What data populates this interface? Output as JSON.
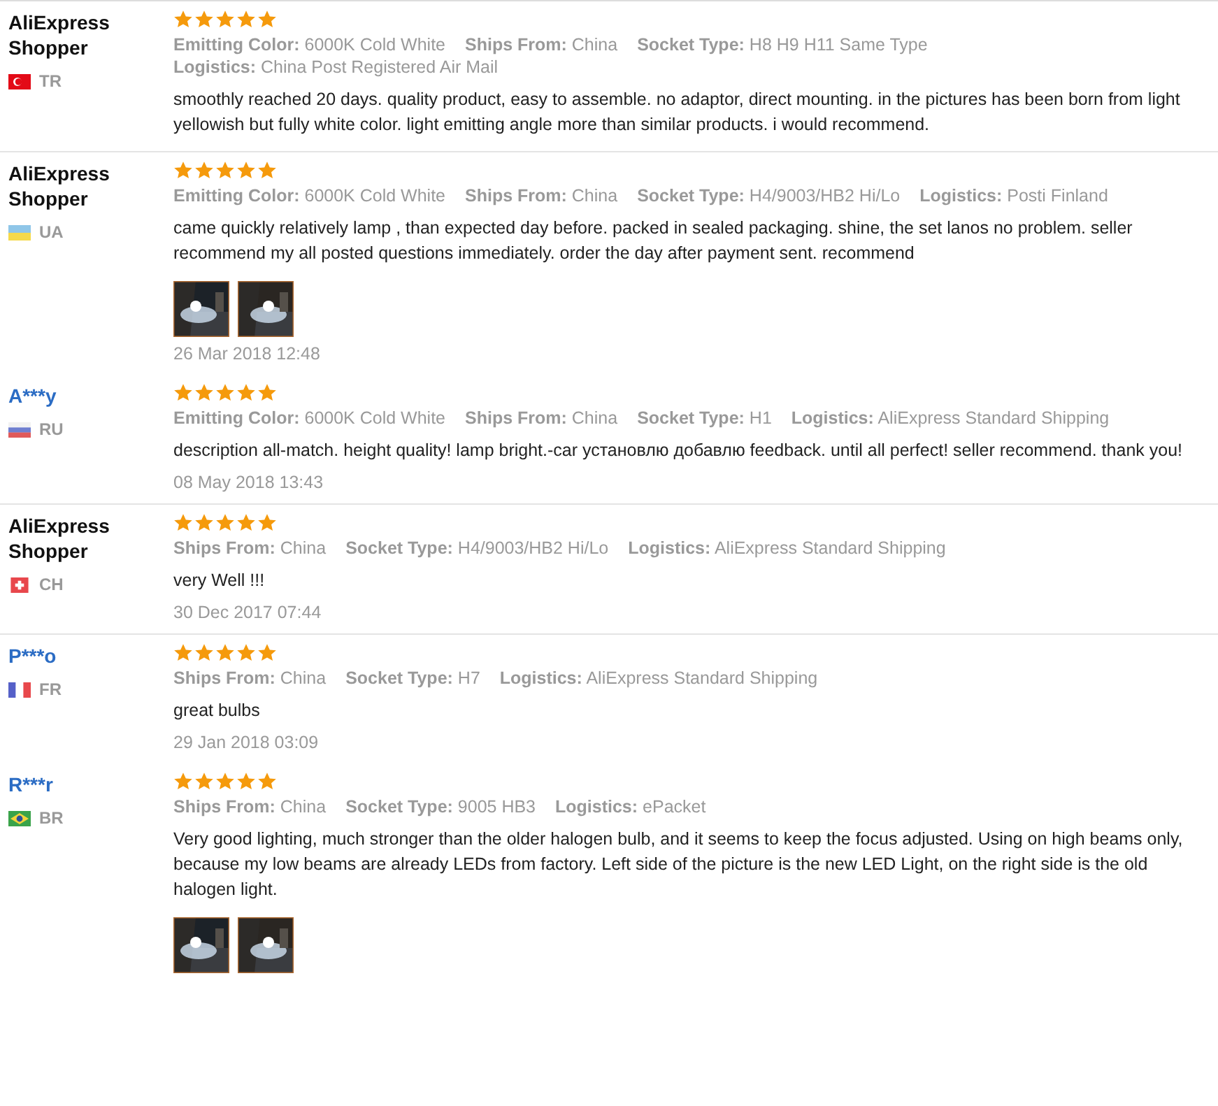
{
  "reviews": [
    {
      "reviewer": {
        "name": "AliExpress Shopper",
        "kind": "guest",
        "flag": {
          "kind": "crescent"
        },
        "country": "TR"
      },
      "stars": 5,
      "attributes": [
        {
          "label": "Emitting Color:",
          "value": "6000K Cold White"
        },
        {
          "label": "Ships From:",
          "value": "China"
        },
        {
          "label": "Socket Type:",
          "value": "H8 H9 H11 Same Type"
        },
        {
          "label": "Logistics:",
          "value": "China Post Registered Air Mail"
        }
      ],
      "text": "smoothly reached 20 days. quality product, easy to assemble. no adaptor, direct mounting. in the pictures has been born from light yellowish but fully white color. light emitting angle more than similar products. i would recommend.",
      "divider_after": true
    },
    {
      "reviewer": {
        "name": "AliExpress Shopper",
        "kind": "guest",
        "flag": {
          "kind": "bicolor"
        },
        "country": "UA"
      },
      "stars": 5,
      "attributes": [
        {
          "label": "Emitting Color:",
          "value": "6000K Cold White"
        },
        {
          "label": "Ships From:",
          "value": "China"
        },
        {
          "label": "Socket Type:",
          "value": "H4/9003/HB2 Hi/Lo"
        },
        {
          "label": "Logistics:",
          "value": "Posti Finland"
        }
      ],
      "text": "came quickly relatively lamp , than expected day before. packed in sealed packaging. shine, the set lanos no problem. seller recommend my all posted questions immediately. order the day after payment sent. recommend",
      "photos": [
        {
          "kind": "picture"
        },
        {
          "kind": "picture"
        }
      ],
      "date": "26 Mar 2018 12:48",
      "divider_after": false
    },
    {
      "reviewer": {
        "name": "A***y",
        "kind": "member",
        "flag": {
          "kind": "tricolor"
        },
        "country": "RU"
      },
      "stars": 5,
      "attributes": [
        {
          "label": "Emitting Color:",
          "value": "6000K Cold White"
        },
        {
          "label": "Ships From:",
          "value": "China"
        },
        {
          "label": "Socket Type:",
          "value": "H1"
        },
        {
          "label": "Logistics:",
          "value": "AliExpress Standard Shipping"
        }
      ],
      "text": "description all-match. height quality! lamp bright.-car установлю добавлю feedback. until all perfect! seller recommend. thank you!",
      "date": "08 May 2018 13:43",
      "divider_after": true
    },
    {
      "reviewer": {
        "name": "AliExpress Shopper",
        "kind": "guest",
        "flag": {
          "kind": "cross"
        },
        "country": "CH"
      },
      "stars": 5,
      "attributes": [
        {
          "label": "Ships From:",
          "value": "China"
        },
        {
          "label": "Socket Type:",
          "value": "H4/9003/HB2 Hi/Lo"
        },
        {
          "label": "Logistics:",
          "value": "AliExpress Standard Shipping"
        }
      ],
      "text": "very Well !!!",
      "date": "30 Dec 2017 07:44",
      "divider_after": true
    },
    {
      "reviewer": {
        "name": "P***o",
        "kind": "member",
        "flag": {
          "kind": "bands"
        },
        "country": "FR"
      },
      "stars": 5,
      "attributes": [
        {
          "label": "Ships From:",
          "value": "China"
        },
        {
          "label": "Socket Type:",
          "value": "H7"
        },
        {
          "label": "Logistics:",
          "value": "AliExpress Standard Shipping"
        }
      ],
      "text": "great bulbs",
      "date": "29 Jan 2018 03:09",
      "divider_after": false
    },
    {
      "reviewer": {
        "name": "R***r",
        "kind": "member",
        "flag": {
          "kind": "diamond"
        },
        "country": "BR"
      },
      "stars": 5,
      "attributes": [
        {
          "label": "Ships From:",
          "value": "China"
        },
        {
          "label": "Socket Type:",
          "value": "9005 HB3"
        },
        {
          "label": "Logistics:",
          "value": "ePacket"
        }
      ],
      "text": "Very good lighting, much stronger than the older halogen bulb, and it seems to keep the focus adjusted. Using on high beams only, because my low beams are already LEDs from factory. Left side of the picture is the new LED Light, on the right side is the old halogen light.",
      "photos": [
        {
          "kind": "picture"
        },
        {
          "kind": "picture"
        }
      ],
      "divider_after": false
    }
  ]
}
